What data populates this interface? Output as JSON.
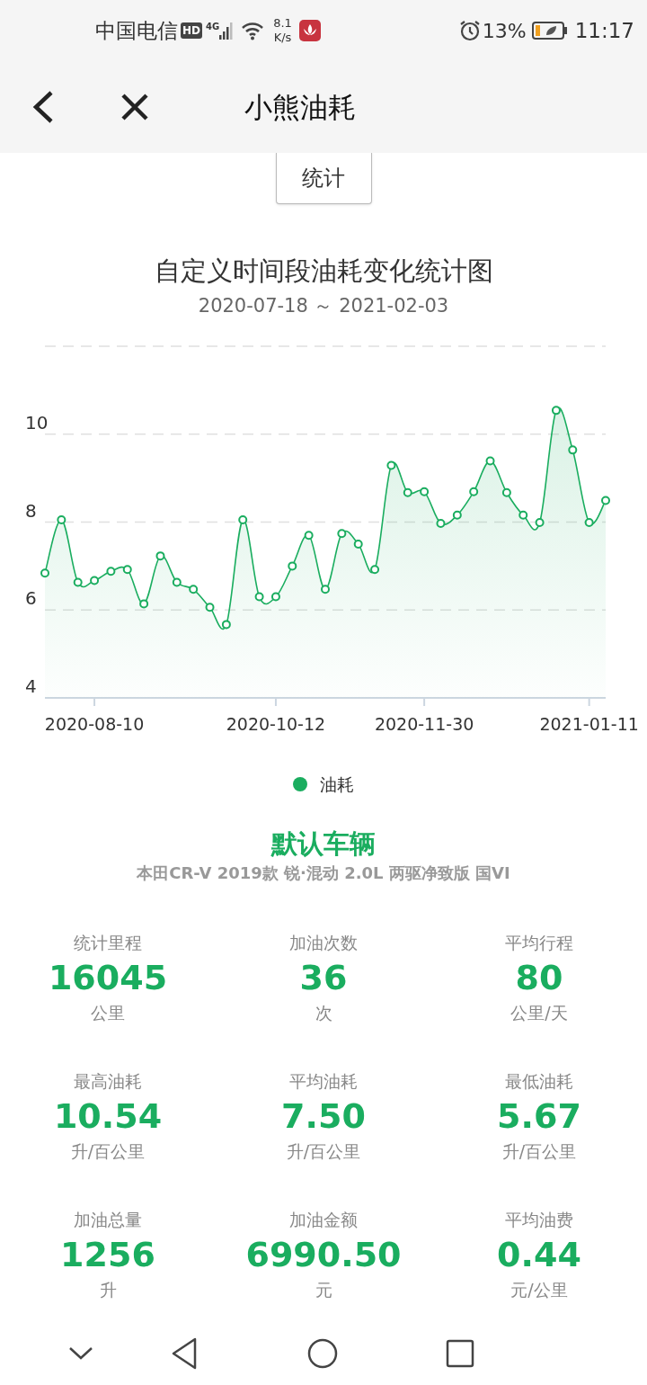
{
  "status_bar": {
    "carrier": "中国电信",
    "hd_badge": "HD",
    "network": "4G",
    "speed_value": "8.1",
    "speed_unit": "K/s",
    "battery_percent": "13%",
    "time": "11:17"
  },
  "header": {
    "title": "小熊油耗"
  },
  "tab_button": {
    "label": "统计"
  },
  "chart_section": {
    "title": "自定义时间段油耗变化统计图",
    "date_range": "2020-07-18 ～ 2021-02-03",
    "chart_data": {
      "type": "area",
      "categories": [
        null,
        null,
        null,
        "2020-08-10",
        null,
        null,
        null,
        null,
        null,
        null,
        null,
        null,
        null,
        null,
        "2020-10-12",
        null,
        null,
        null,
        null,
        null,
        null,
        null,
        null,
        "2020-11-30",
        null,
        null,
        null,
        null,
        null,
        null,
        null,
        null,
        null,
        "2021-01-11",
        null
      ],
      "series": [
        {
          "name": "油耗",
          "color": "#1aad5f",
          "values": [
            6.84,
            8.05,
            6.63,
            6.67,
            6.88,
            6.92,
            6.14,
            7.23,
            6.63,
            6.47,
            6.06,
            5.67,
            8.05,
            6.3,
            6.3,
            7.0,
            7.7,
            6.47,
            7.74,
            7.5,
            6.92,
            9.29,
            8.67,
            8.69,
            7.97,
            8.16,
            8.69,
            9.39,
            8.67,
            8.16,
            7.99,
            10.54,
            9.64,
            7.99,
            8.49
          ]
        }
      ],
      "ylim": [
        4,
        12
      ],
      "yticks": [
        4,
        6,
        8,
        10
      ],
      "grid": true
    }
  },
  "vehicle": {
    "name": "默认车辆",
    "model": "本田CR-V 2019款 锐·混动 2.0L 两驱净致版 国VI"
  },
  "stats": [
    {
      "label": "统计里程",
      "value": "16045",
      "unit": "公里"
    },
    {
      "label": "加油次数",
      "value": "36",
      "unit": "次"
    },
    {
      "label": "平均行程",
      "value": "80",
      "unit": "公里/天"
    },
    {
      "label": "最高油耗",
      "value": "10.54",
      "unit": "升/百公里"
    },
    {
      "label": "平均油耗",
      "value": "7.50",
      "unit": "升/百公里"
    },
    {
      "label": "最低油耗",
      "value": "5.67",
      "unit": "升/百公里"
    },
    {
      "label": "加油总量",
      "value": "1256",
      "unit": "升"
    },
    {
      "label": "加油金额",
      "value": "6990.50",
      "unit": "元"
    },
    {
      "label": "平均油费",
      "value": "0.44",
      "unit": "元/公里"
    }
  ]
}
